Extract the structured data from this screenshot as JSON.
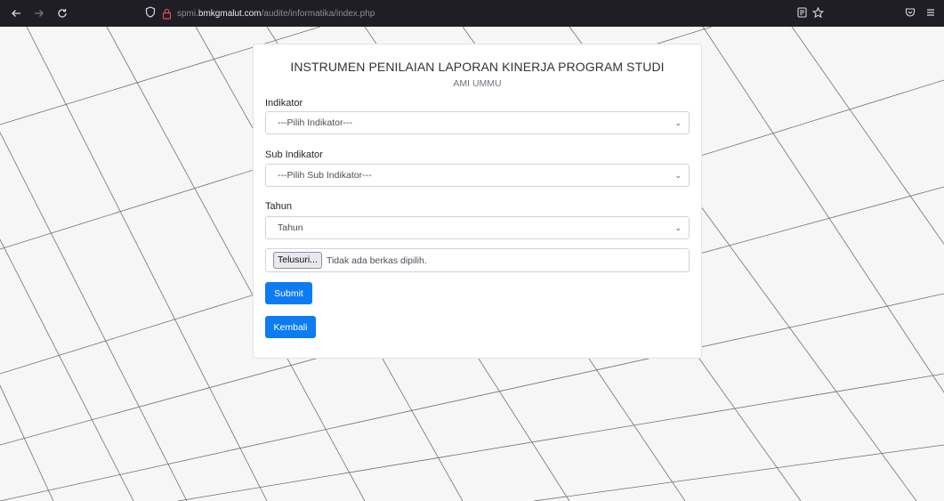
{
  "browser": {
    "url_prefix": "spmi.",
    "url_domain": "bmkgmalut.com",
    "url_path": "/audite/informatika/index.php",
    "icons": [
      "back-icon",
      "forward-icon",
      "reload-icon",
      "tracking-shield-icon",
      "lock-icon",
      "reader-view-icon",
      "bookmark-star-icon",
      "pocket-icon",
      "menu-icon"
    ]
  },
  "form": {
    "title": "INSTRUMEN PENILAIAN LAPORAN KINERJA PROGRAM STUDI",
    "subtitle": "AMI UMMU",
    "indikator": {
      "label": "Indikator",
      "value": "---Pilih Indikator---"
    },
    "sub_indikator": {
      "label": "Sub Indikator",
      "value": "---Pilih Sub Indikator---"
    },
    "tahun": {
      "label": "Tahun",
      "value": "Tahun"
    },
    "file": {
      "button_label": "Telusuri...",
      "status": "Tidak ada berkas dipilih."
    },
    "submit_label": "Submit",
    "back_label": "Kembali"
  },
  "colors": {
    "primary": "#0d7cf2",
    "chrome": "#1f1e25",
    "background": "#f6f6f6"
  }
}
